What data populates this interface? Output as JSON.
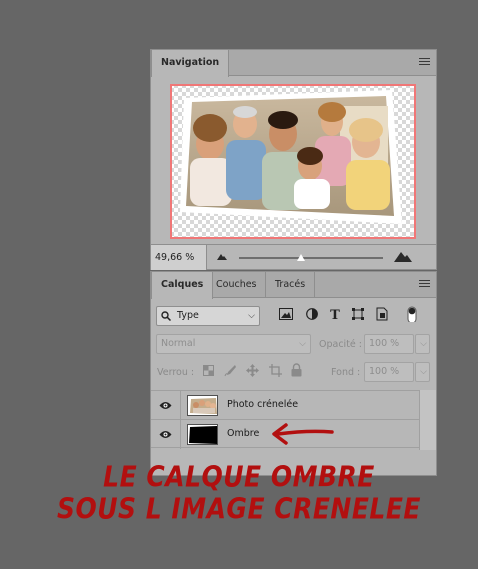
{
  "navigator": {
    "tab": "Navigation",
    "zoom": "49,66 %",
    "zoom_level_fraction": 0.43
  },
  "layers_panel": {
    "tabs": [
      "Calques",
      "Couches",
      "Tracés"
    ],
    "filter_select": "Type",
    "blend_mode": "Normal",
    "opacity_label": "Opacité :",
    "opacity_value": "100 %",
    "lock_label": "Verrou :",
    "fill_label": "Fond :",
    "fill_value": "100 %",
    "layers": [
      {
        "name": "Photo crénelée",
        "thumbnail": "family-photo"
      },
      {
        "name": "Ombre",
        "thumbnail": "black-shape"
      }
    ]
  },
  "annotation": {
    "line1": "LE CALQUE OMBRE",
    "line2": "SOUS L IMAGE CRENELEE",
    "color": "#b20f0f"
  },
  "colors": {
    "background": "#666666",
    "panel": "#b7b7b7",
    "proxy_frame": "#f07777"
  }
}
